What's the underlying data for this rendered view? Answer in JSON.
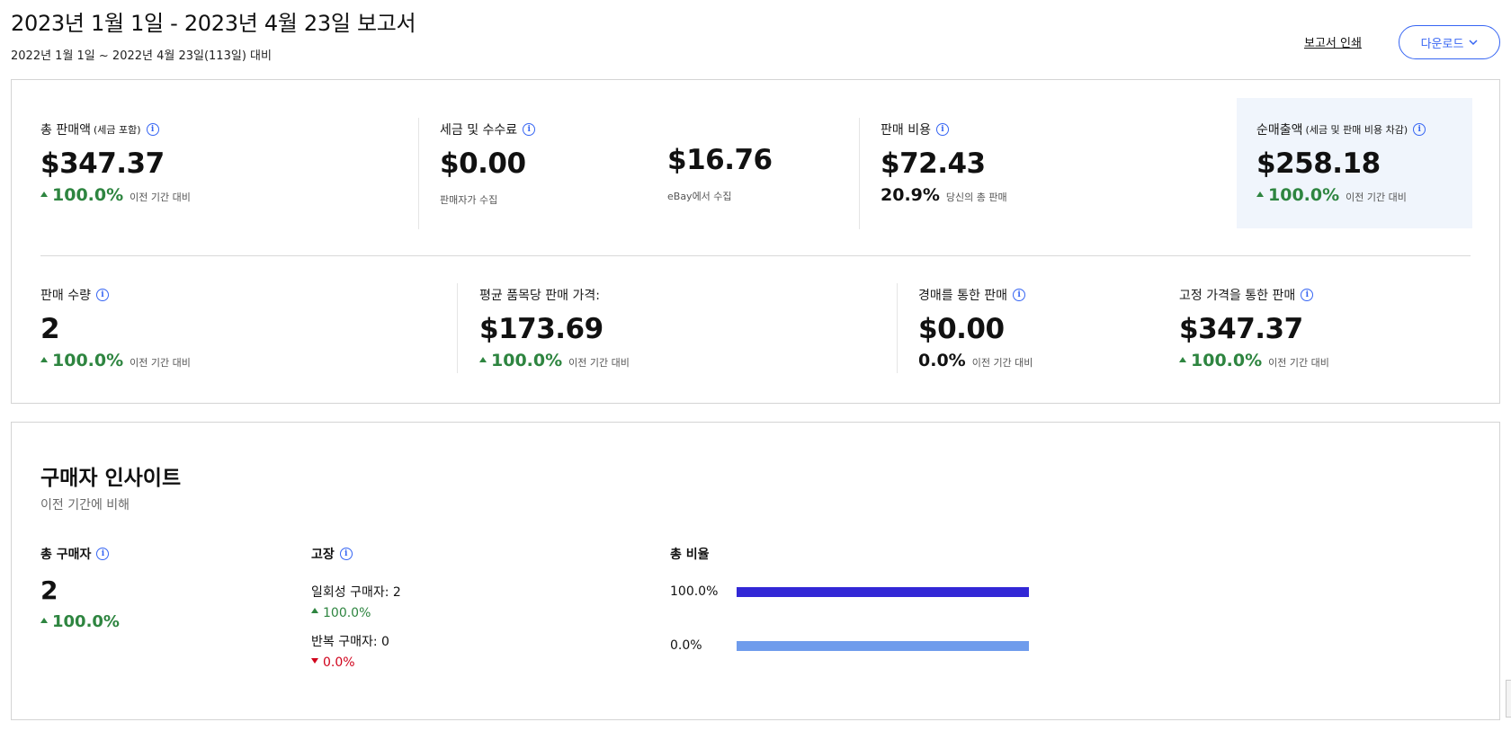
{
  "header": {
    "title": "2023년 1월 1일 - 2023년 4월 23일 보고서",
    "subtitle": "2022년 1월 1일 ~ 2022년 4월 23일(113일) 대비",
    "print_label": "보고서 인쇄",
    "download_label": "다운로드"
  },
  "metrics_top": [
    {
      "label": "총 판매액",
      "label_note": "(세금 포함)",
      "value": "$347.37",
      "change": "100.0%",
      "compare": "이전 기간 대비"
    },
    {
      "label": "세금 및 수수료",
      "value_a": "$0.00",
      "note_a": "판매자가 수집",
      "value_b": "$16.76",
      "note_b": "eBay에서 수집"
    },
    {
      "label": "판매 비용",
      "value": "$72.43",
      "change": "20.9%",
      "compare": "당신의 총 판매"
    },
    {
      "label": "순매출액",
      "label_note": "(세금 및 판매 비용 차감)",
      "value": "$258.18",
      "change": "100.0%",
      "compare": "이전 기간 대비"
    }
  ],
  "metrics_bottom": [
    {
      "label": "판매 수량",
      "value": "2",
      "change": "100.0%",
      "compare": "이전 기간 대비"
    },
    {
      "label": "평균 품목당 판매 가격:",
      "value": "$173.69",
      "change": "100.0%",
      "compare": "이전 기간 대비"
    },
    {
      "label": "경매를 통한 판매",
      "value": "$0.00",
      "change": "0.0%",
      "compare": "이전 기간 대비"
    },
    {
      "label": "고정 가격을 통한 판매",
      "value": "$347.37",
      "change": "100.0%",
      "compare": "이전 기간 대비"
    }
  ],
  "buyer_insights": {
    "title": "구매자 인사이트",
    "subtitle": "이전 기간에 비해",
    "total_buyers": {
      "label": "총 구매자",
      "value": "2",
      "change": "100.0%"
    },
    "breakdown": {
      "label": "고장",
      "one_time": {
        "text": "일회성 구매자: 2",
        "change": "100.0%"
      },
      "repeat": {
        "text": "반복 구매자: 0",
        "change": "0.0%"
      }
    },
    "ratio": {
      "label": "총 비율",
      "rows": [
        {
          "pct": "100.0%",
          "color": "#3228d6"
        },
        {
          "pct": "0.0%",
          "color": "#6f9cec"
        }
      ]
    }
  }
}
